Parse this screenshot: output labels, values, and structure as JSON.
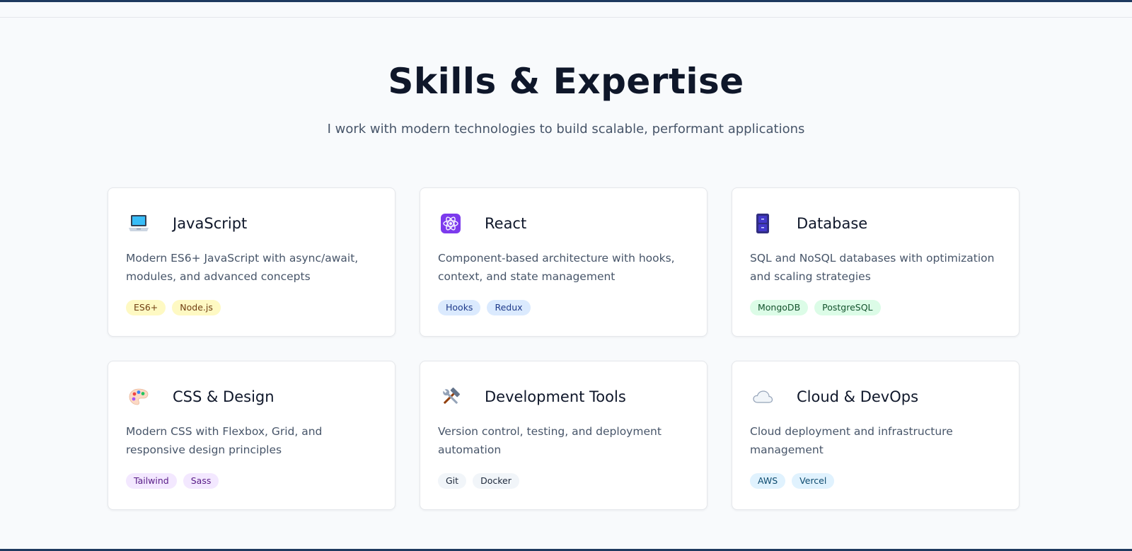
{
  "section": {
    "title": "Skills & Expertise",
    "subtitle": "I work with modern technologies to build scalable, performant applications"
  },
  "cards": [
    {
      "icon": "laptop-icon",
      "title": "JavaScript",
      "description": "Modern ES6+ JavaScript with async/await, modules, and advanced concepts",
      "tags": [
        "ES6+",
        "Node.js"
      ],
      "tag_color": "yellow"
    },
    {
      "icon": "atom-icon",
      "title": "React",
      "description": "Component-based architecture with hooks, context, and state management",
      "tags": [
        "Hooks",
        "Redux"
      ],
      "tag_color": "blue"
    },
    {
      "icon": "file-cabinet-icon",
      "title": "Database",
      "description": "SQL and NoSQL databases with optimization and scaling strategies",
      "tags": [
        "MongoDB",
        "PostgreSQL"
      ],
      "tag_color": "green"
    },
    {
      "icon": "palette-icon",
      "title": "CSS & Design",
      "description": "Modern CSS with Flexbox, Grid, and responsive design principles",
      "tags": [
        "Tailwind",
        "Sass"
      ],
      "tag_color": "purple"
    },
    {
      "icon": "hammer-wrench-icon",
      "title": "Development Tools",
      "description": "Version control, testing, and deployment automation",
      "tags": [
        "Git",
        "Docker"
      ],
      "tag_color": "gray"
    },
    {
      "icon": "cloud-icon",
      "title": "Cloud & DevOps",
      "description": "Cloud deployment and infrastructure management",
      "tags": [
        "AWS",
        "Vercel"
      ],
      "tag_color": "sky"
    }
  ],
  "colors": {
    "accent_bar": "#1e3a5f",
    "background": "#f8fafc",
    "heading": "#0f172a",
    "body_text": "#475569"
  }
}
